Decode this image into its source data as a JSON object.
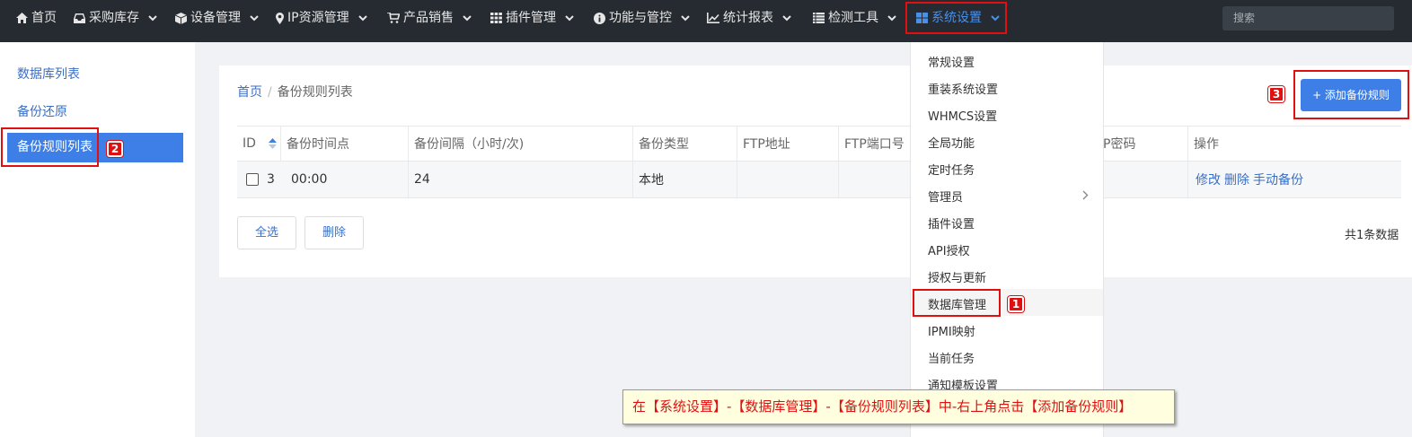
{
  "nav": {
    "items": [
      {
        "label": "首页",
        "icon": "home-icon"
      },
      {
        "label": "采购库存",
        "icon": "inbox-icon"
      },
      {
        "label": "设备管理",
        "icon": "cube-icon"
      },
      {
        "label": "IP资源管理",
        "icon": "map-marker-icon"
      },
      {
        "label": "产品销售",
        "icon": "cart-icon"
      },
      {
        "label": "插件管理",
        "icon": "grid-icon"
      },
      {
        "label": "功能与管控",
        "icon": "info-icon"
      },
      {
        "label": "统计报表",
        "icon": "chart-icon"
      },
      {
        "label": "检测工具",
        "icon": "list-icon"
      },
      {
        "label": "系统设置",
        "icon": "windows-icon"
      }
    ],
    "search_placeholder": "搜索"
  },
  "sidebar": {
    "items": [
      {
        "label": "数据库列表"
      },
      {
        "label": "备份还原"
      },
      {
        "label": "备份规则列表"
      }
    ]
  },
  "breadcrumb": {
    "home": "首页",
    "sep": "/",
    "current": "备份规则列表"
  },
  "add_button": "+ 添加备份规则",
  "table": {
    "headers": [
      "ID",
      "备份时间点",
      "备份间隔（小时/次)",
      "备份类型",
      "FTP地址",
      "FTP端口号",
      "P密码",
      "操作"
    ],
    "rows": [
      {
        "id": "3",
        "time": "00:00",
        "interval": "24",
        "type": "本地",
        "ops": [
          "修改",
          "删除",
          "手动备份"
        ]
      }
    ]
  },
  "buttons": {
    "select_all": "全选",
    "delete": "删除"
  },
  "total": "共1条数据",
  "dropdown": {
    "items": [
      "常规设置",
      "重装系统设置",
      "WHMCS设置",
      "全局功能",
      "定时任务",
      "管理员",
      "插件设置",
      "API授权",
      "授权与更新",
      "数据库管理",
      "IPMI映射",
      "当前任务",
      "通知模板设置"
    ]
  },
  "badges": [
    "1",
    "2",
    "3"
  ],
  "tooltip": "在【系统设置】-【数据库管理】-【备份规则列表】中-右上角点击【添加备份规则】",
  "colors": {
    "nav_bg": "#262b31",
    "accent": "#3d7fe6",
    "annotation": "#e01010",
    "link": "#3b6fc4"
  }
}
